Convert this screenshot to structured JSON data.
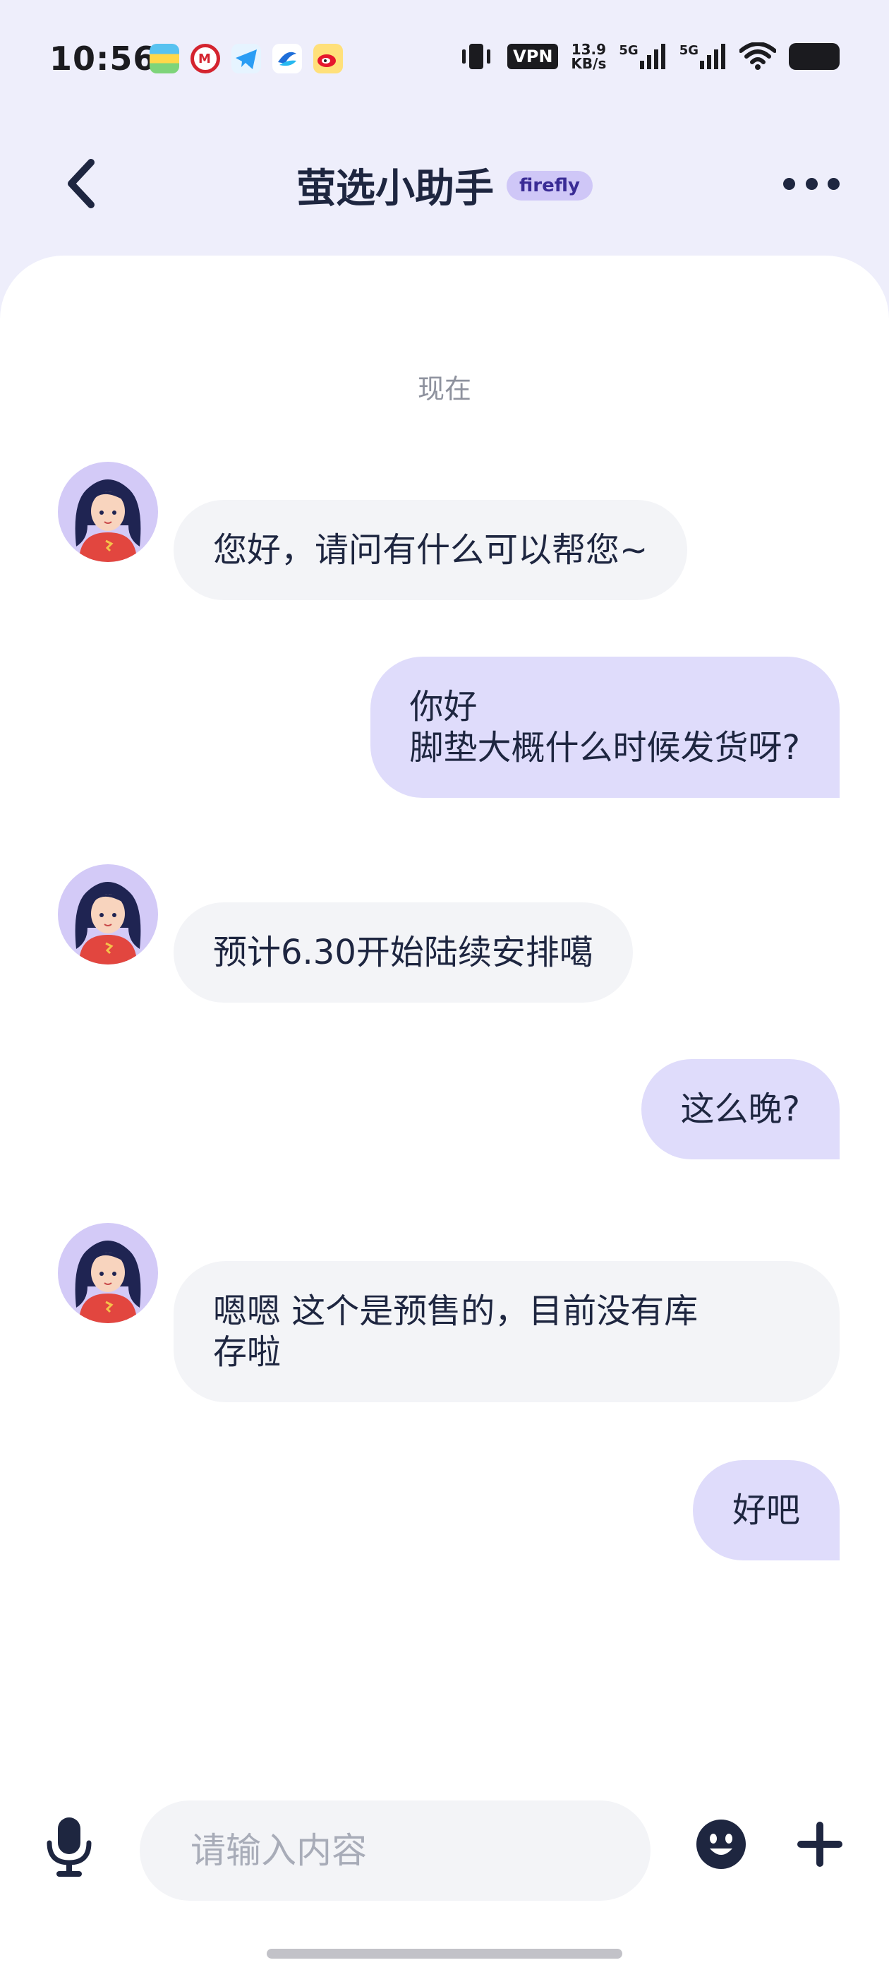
{
  "status_bar": {
    "time": "10:56",
    "vpn_label": "VPN",
    "network_speed": "13.9",
    "network_speed_unit": "KB/s",
    "signal1_label": "5G",
    "signal2_label": "5G"
  },
  "header": {
    "title": "萤选小助手",
    "badge": "firefly"
  },
  "chat": {
    "timestamp": "现在",
    "messages": [
      {
        "side": "left",
        "text": "您好，请问有什么可以帮您~"
      },
      {
        "side": "right",
        "line1": "你好",
        "line2": "脚垫大概什么时候发货呀?"
      },
      {
        "side": "left",
        "text": "预计6.30开始陆续安排噶"
      },
      {
        "side": "right",
        "text": "这么晚?"
      },
      {
        "side": "left",
        "line1": "嗯嗯 这个是预售的，目前没有库",
        "line2": "存啦"
      },
      {
        "side": "right",
        "text": "好吧"
      }
    ]
  },
  "input": {
    "placeholder": "请输入内容"
  },
  "colors": {
    "accent_bubble": "#DFDCFB",
    "incoming_bubble": "#F3F4F7",
    "header_bg": "#EEEEFB",
    "badge_bg": "#CFC7F7",
    "icon_dark": "#1E2640"
  }
}
